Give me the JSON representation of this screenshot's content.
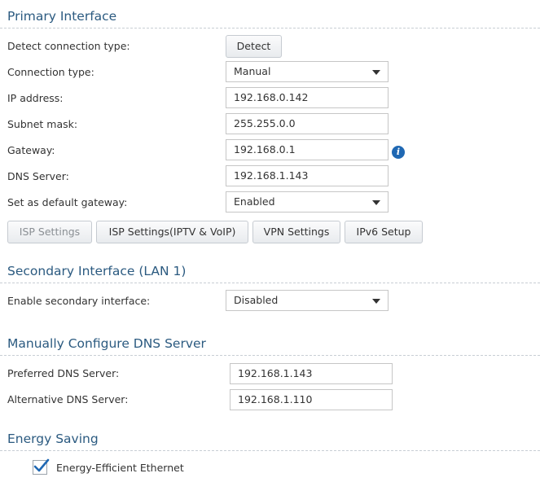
{
  "primary": {
    "title": "Primary Interface",
    "detect_label": "Detect connection type:",
    "detect_button": "Detect",
    "connection_type_label": "Connection type:",
    "connection_type_value": "Manual",
    "ip_label": "IP address:",
    "ip_value": "192.168.0.142",
    "subnet_label": "Subnet mask:",
    "subnet_value": "255.255.0.0",
    "gateway_label": "Gateway:",
    "gateway_value": "192.168.0.1",
    "dns_label": "DNS Server:",
    "dns_value": "192.168.1.143",
    "default_gw_label": "Set as default gateway:",
    "default_gw_value": "Enabled",
    "buttons": {
      "isp": "ISP Settings",
      "isp_iptv": "ISP Settings(IPTV & VoIP)",
      "vpn": "VPN Settings",
      "ipv6": "IPv6 Setup"
    }
  },
  "secondary": {
    "title": "Secondary Interface (LAN 1)",
    "enable_label": "Enable secondary interface:",
    "enable_value": "Disabled"
  },
  "dns": {
    "title": "Manually Configure DNS Server",
    "preferred_label": "Preferred DNS Server:",
    "preferred_value": "192.168.1.143",
    "alternative_label": "Alternative DNS Server:",
    "alternative_value": "192.168.1.110"
  },
  "energy": {
    "title": "Energy Saving",
    "eee_label": "Energy-Efficient Ethernet",
    "eee_checked": true
  },
  "colors": {
    "section_title": "#2b5a80",
    "info_icon": "#1f68b3",
    "checkmark": "#1f68b3"
  },
  "icons": {
    "info": "info-icon",
    "dropdown": "chevron-down-icon",
    "check": "checkmark-icon"
  }
}
